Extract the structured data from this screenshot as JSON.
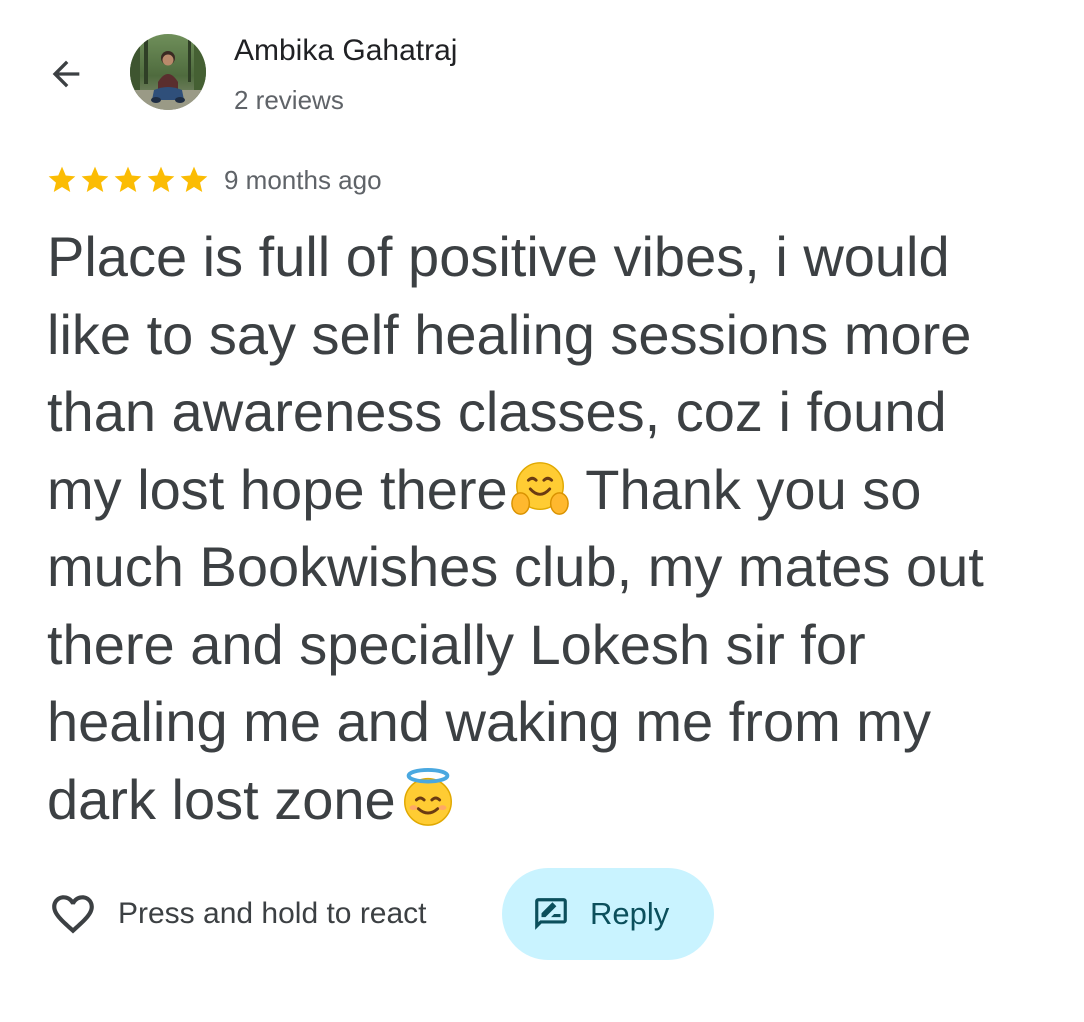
{
  "author": {
    "name": "Ambika Gahatraj",
    "review_count": "2 reviews"
  },
  "review": {
    "rating": 5,
    "rating_max": 5,
    "star_color": "#fbbc04",
    "time_ago": "9 months ago",
    "lines": [
      "Place is full of positive vibes, i would",
      "like to say self healing sessions more",
      "than awareness classes, coz i found",
      "my lost hope there",
      " Thank you so",
      "much Bookwishes club, my mates out",
      "there and specially Lokesh sir for",
      "healing me and waking me from my",
      "dark lost zone"
    ],
    "emojis": [
      "hugging-face-emoji",
      "smiling-face-with-halo-emoji"
    ]
  },
  "actions": {
    "react_label": "Press and hold to react",
    "reply_label": "Reply",
    "reply_bg": "#c9f3ff"
  },
  "icons": {
    "back": "arrow-back-icon",
    "react": "heart-outline-icon",
    "reply": "rate-review-icon"
  }
}
